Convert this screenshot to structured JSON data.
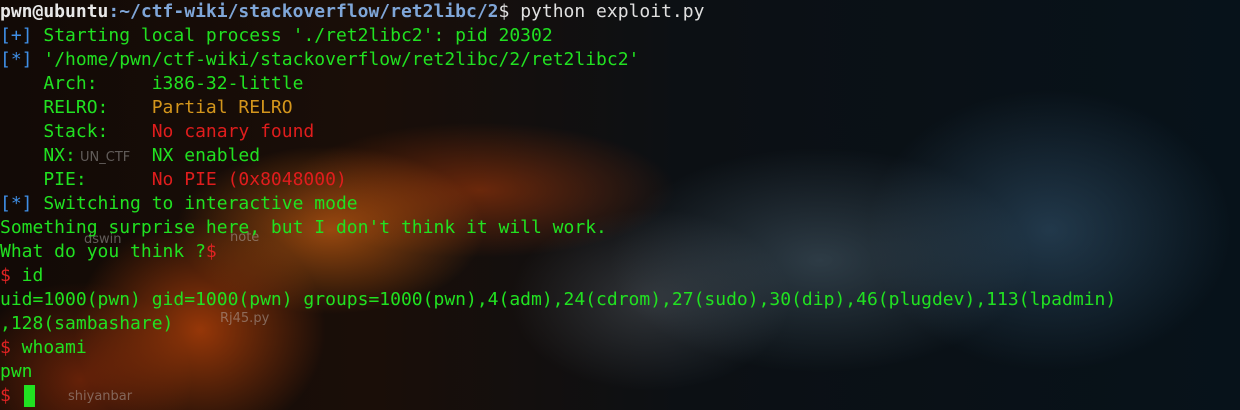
{
  "prompt": {
    "user_host": "pwn@ubuntu",
    "path": ":~/ctf-wiki/stackoverflow/ret2libc/2",
    "symbol": "$",
    "command": " python exploit.py"
  },
  "output": {
    "start_tag": "[+]",
    "start_text": " Starting local process './ret2libc2': pid 20302",
    "file_tag": "[*]",
    "file_text": " '/home/pwn/ctf-wiki/stackoverflow/ret2libc/2/ret2libc2'",
    "checksec": [
      {
        "key": "    Arch:     ",
        "value": "i386-32-little",
        "color": "#21e121"
      },
      {
        "key": "    RELRO:    ",
        "value": "Partial RELRO",
        "color": "#d4961c"
      },
      {
        "key": "    Stack:    ",
        "value": "No canary found",
        "color": "#e01d1d"
      },
      {
        "key": "    NX:       ",
        "value": "NX enabled",
        "color": "#21e121"
      },
      {
        "key": "    PIE:      ",
        "value": "No PIE (0x8048000)",
        "color": "#e01d1d"
      }
    ],
    "switch_tag": "[*]",
    "switch_text": " Switching to interactive mode",
    "surprise": "Something surprise here, but I don't think it will work.",
    "question": "What do you think ?",
    "question_dollar": "$",
    "shell_prompt": "$",
    "cmd_id": " id",
    "id_output_1": "uid=1000(pwn) gid=1000(pwn) groups=1000(pwn),4(adm),24(cdrom),27(sudo),30(dip),46(plugdev),113(lpadmin)",
    "id_output_2": ",128(sambashare)",
    "cmd_whoami": " whoami",
    "whoami_output": "pwn"
  },
  "desktop_icons": {
    "icon_1": "UN_CTF",
    "icon_2": "dswin",
    "icon_3": "note",
    "icon_4": "Rj45.py",
    "icon_5": "shiyanbar"
  },
  "colors": {
    "text_green": "#21e121",
    "tag_blue": "#3f8fe6",
    "warn_orange": "#d4961c",
    "error_red": "#e01d1d"
  }
}
